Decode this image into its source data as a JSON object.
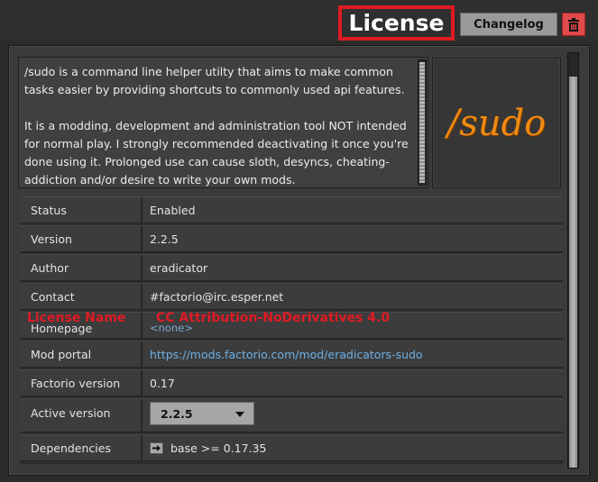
{
  "header": {
    "license_title": "License",
    "changelog_label": "Changelog"
  },
  "description": {
    "paragraph1": "/sudo is a command line helper utilty that aims to make common tasks easier by providing shortcuts to commonly used api features.",
    "paragraph2": "It is a modding, development and administration tool NOT intended for normal play. I strongly recommended deactivating it once you're done using it. Prolonged use can cause sloth, desyncs, cheating-addiction and/or desire to write your own mods."
  },
  "logo": {
    "text": "/sudo"
  },
  "details": {
    "rows": [
      {
        "label": "Status",
        "value": "Enabled"
      },
      {
        "label": "Version",
        "value": "2.2.5"
      },
      {
        "label": "Author",
        "value": "eradicator"
      },
      {
        "label": "Contact",
        "value": "#factorio@irc.esper.net"
      },
      {
        "label": "Homepage",
        "value": "<none>"
      },
      {
        "label": "Mod portal",
        "value": "https://mods.factorio.com/mod/eradicators-sudo"
      },
      {
        "label": "Factorio version",
        "value": "0.17"
      },
      {
        "label": "Active version",
        "value": "2.2.5"
      },
      {
        "label": "Dependencies",
        "value": "base >= 0.17.35"
      }
    ]
  },
  "license_overlay": {
    "name": "License Name",
    "value": "CC Attribution-NoDerivatives 4.0"
  },
  "colors": {
    "accent_red": "#e01b24",
    "link_blue": "#6cb0e6",
    "logo_orange": "#f08a12"
  }
}
